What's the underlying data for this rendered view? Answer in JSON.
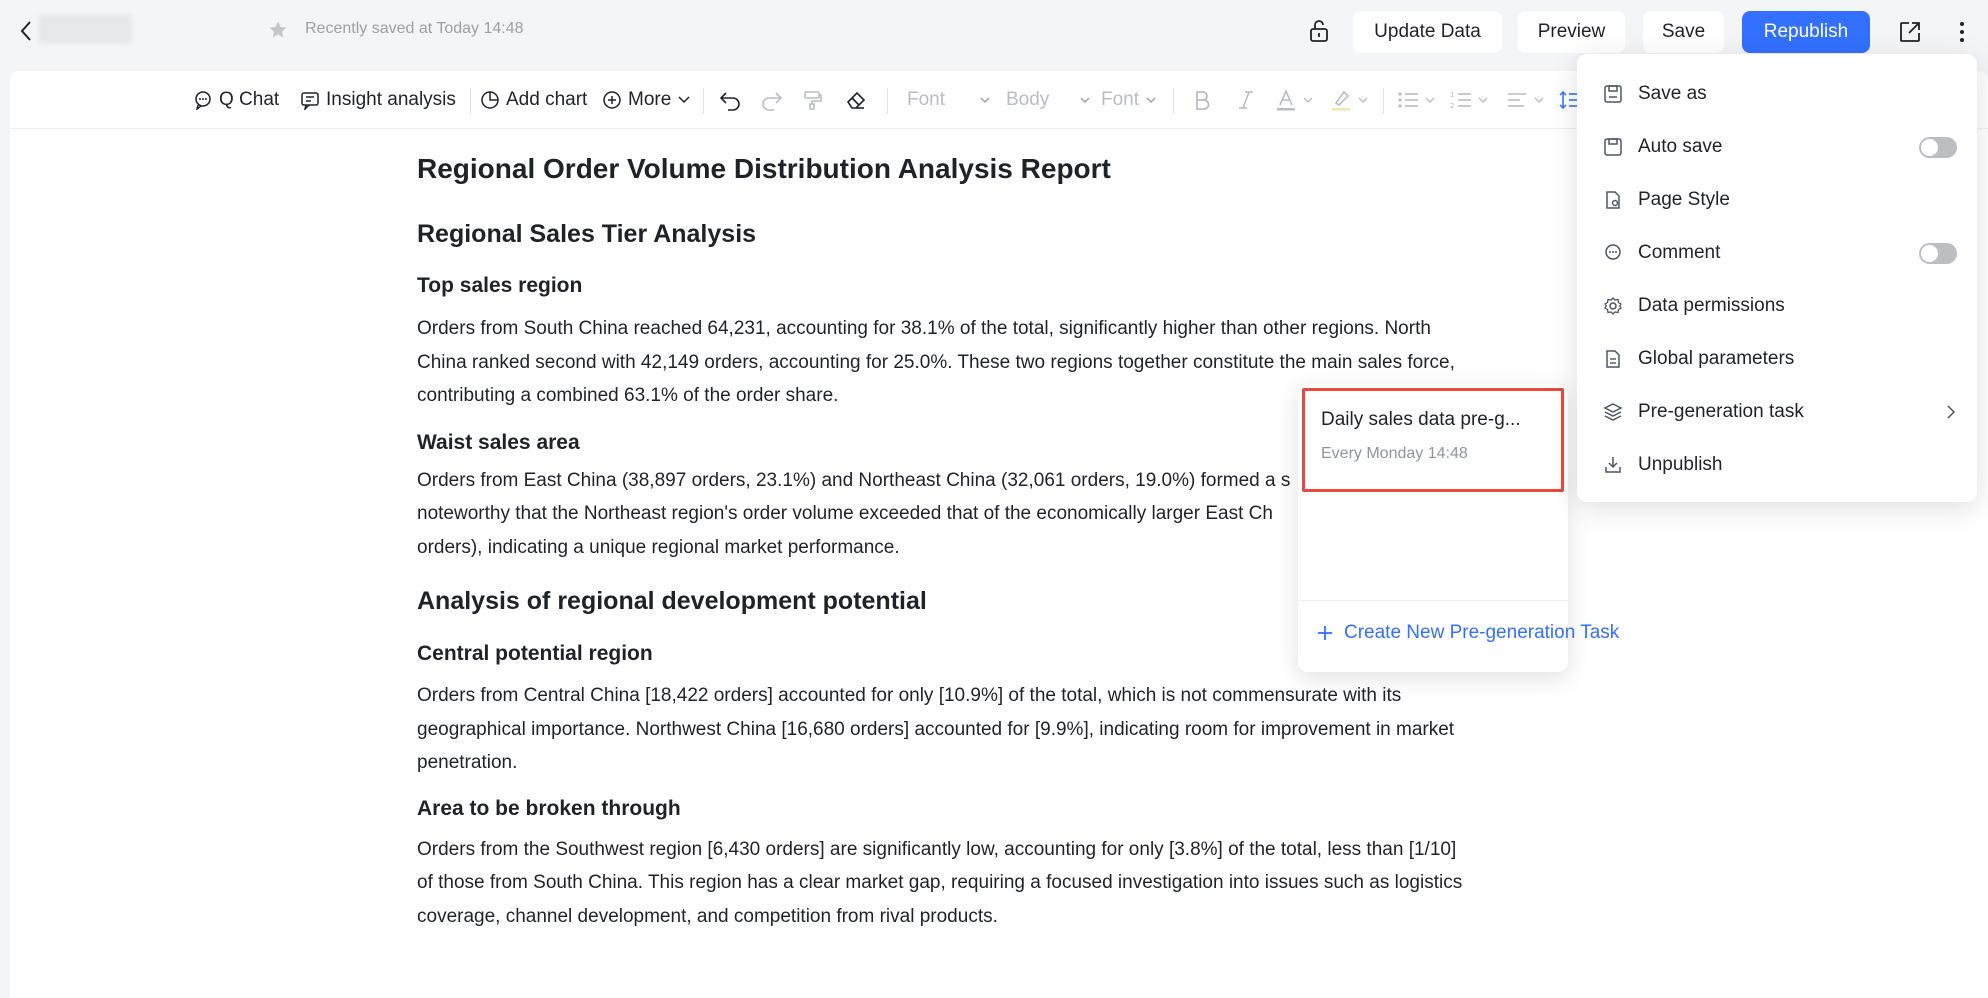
{
  "header": {
    "saved_status": "Recently saved at Today 14:48",
    "buttons": {
      "update_data": "Update Data",
      "preview": "Preview",
      "save": "Save",
      "republish": "Republish"
    },
    "accent_color": "#3370ff"
  },
  "toolbar": {
    "q_chat": "Q Chat",
    "insight_analysis": "Insight analysis",
    "add_chart": "Add chart",
    "more": "More",
    "font_family": "Font",
    "paragraph_style": "Body",
    "font_size": "Font"
  },
  "document": {
    "title": "Regional Order Volume Distribution Analysis Report",
    "sections": [
      {
        "heading": "Regional Sales Tier Analysis",
        "subsections": [
          {
            "heading": "Top sales region",
            "lines": [
              "Orders from South China reached 64,231, accounting for 38.1% of the total, significantly higher than other regions. North",
              "China ranked second with 42,149 orders, accounting for 25.0%. These two regions together constitute the main sales force,",
              "contributing a combined 63.1% of the order share."
            ]
          },
          {
            "heading": "Waist sales area",
            "lines": [
              "Orders from East China (38,897 orders, 23.1%) and Northeast China (32,061 orders, 19.0%) formed a s",
              "noteworthy that the Northeast region's order volume exceeded that of the economically larger East Ch",
              "orders), indicating a unique regional market performance."
            ]
          }
        ]
      },
      {
        "heading": "Analysis of regional development potential",
        "subsections": [
          {
            "heading": "Central potential region",
            "lines": [
              "Orders from Central China [18,422 orders] accounted for only [10.9%] of the total, which is not commensurate with its",
              "geographical importance. Northwest China [16,680 orders] accounted for [9.9%], indicating room for improvement in market",
              "penetration."
            ]
          },
          {
            "heading": "Area to be broken through",
            "lines": [
              "Orders from the Southwest region [6,430 orders] are significantly low, accounting for only [3.8%] of the total, less than [1/10]",
              "of those from South China. This region has a clear market gap, requiring a focused investigation into issues such as logistics",
              "coverage, channel development, and competition from rival products."
            ]
          }
        ]
      }
    ]
  },
  "pregeneration_popover": {
    "task_name": "Daily sales data pre-g...",
    "task_schedule": "Every Monday 14:48",
    "create_label": "Create New Pre-generation Task",
    "highlight_color": "#e8483f"
  },
  "more_menu": {
    "items": [
      {
        "label": "Save as",
        "icon": "save-as-icon"
      },
      {
        "label": "Auto save",
        "icon": "auto-save-icon",
        "toggle": false
      },
      {
        "label": "Page Style",
        "icon": "page-style-icon"
      },
      {
        "label": "Comment",
        "icon": "comment-icon",
        "toggle": false
      },
      {
        "label": "Data permissions",
        "icon": "gear-icon"
      },
      {
        "label": "Global parameters",
        "icon": "parameters-icon"
      },
      {
        "label": "Pre-generation task",
        "icon": "layers-icon",
        "submenu": true
      },
      {
        "label": "Unpublish",
        "icon": "unpublish-icon"
      }
    ]
  }
}
